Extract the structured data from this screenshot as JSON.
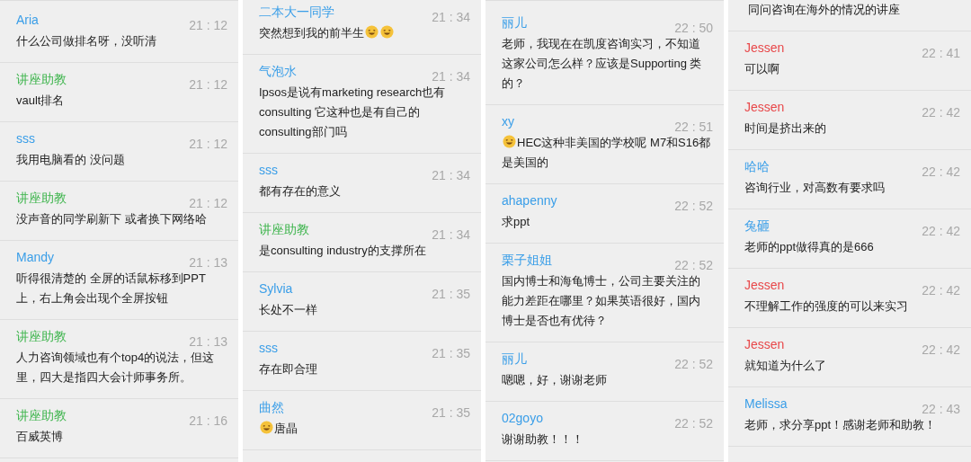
{
  "panels": [
    {
      "messages": [
        {
          "name": "Aria",
          "color": "#3a9ee8",
          "time": "21 : 12",
          "parts": [
            {
              "kind": "text",
              "text": "什么公司做排名呀，没听清"
            }
          ]
        },
        {
          "name": "讲座助教",
          "color": "#3cb44b",
          "time": "21 : 12",
          "parts": [
            {
              "kind": "text",
              "text": "vault排名"
            }
          ]
        },
        {
          "name": "sss",
          "color": "#3a9ee8",
          "time": "21 : 12",
          "parts": [
            {
              "kind": "text",
              "text": "我用电脑看的 没问题"
            }
          ]
        },
        {
          "name": "讲座助教",
          "color": "#3cb44b",
          "time": "21 : 12",
          "parts": [
            {
              "kind": "text",
              "text": "没声音的同学刷新下 或者换下网络哈"
            }
          ]
        },
        {
          "name": "Mandy",
          "color": "#3a9ee8",
          "time": "21 : 13",
          "parts": [
            {
              "kind": "text",
              "text": "听得很清楚的 全屏的话鼠标移到PPT上，右上角会出现个全屏按钮"
            }
          ]
        },
        {
          "name": "讲座助教",
          "color": "#3cb44b",
          "time": "21 : 13",
          "parts": [
            {
              "kind": "text",
              "text": "人力咨询领域也有个top4的说法，但这里，四大是指四大会计师事务所。"
            }
          ]
        },
        {
          "name": "讲座助教",
          "color": "#3cb44b",
          "time": "21 : 16",
          "parts": [
            {
              "kind": "text",
              "text": "百威英博"
            }
          ]
        }
      ]
    },
    {
      "messages": [
        {
          "name": "二本大一同学",
          "color": "#3a9ee8",
          "time": "21 : 34",
          "parts": [
            {
              "kind": "text",
              "text": "突然想到我的前半生"
            },
            {
              "kind": "emoji"
            },
            {
              "kind": "emoji"
            }
          ]
        },
        {
          "name": "气泡水",
          "color": "#3a9ee8",
          "time": "21 : 34",
          "parts": [
            {
              "kind": "text",
              "text": "Ipsos是说有marketing research也有consulting 它这种也是有自己的consulting部门吗"
            }
          ]
        },
        {
          "name": "sss",
          "color": "#3a9ee8",
          "time": "21 : 34",
          "parts": [
            {
              "kind": "text",
              "text": "都有存在的意义"
            }
          ]
        },
        {
          "name": "讲座助教",
          "color": "#3cb44b",
          "time": "21 : 34",
          "parts": [
            {
              "kind": "text",
              "text": "是consulting industry的支撑所在"
            }
          ]
        },
        {
          "name": "Sylvia",
          "color": "#3a9ee8",
          "time": "21 : 35",
          "parts": [
            {
              "kind": "text",
              "text": "长处不一样"
            }
          ]
        },
        {
          "name": "sss",
          "color": "#3a9ee8",
          "time": "21 : 35",
          "parts": [
            {
              "kind": "text",
              "text": "存在即合理"
            }
          ]
        },
        {
          "name": "曲然",
          "color": "#3a9ee8",
          "time": "21 : 35",
          "parts": [
            {
              "kind": "emoji"
            },
            {
              "kind": "text",
              "text": "唐晶"
            }
          ]
        }
      ]
    },
    {
      "messages": [
        {
          "name": "丽儿",
          "color": "#3a9ee8",
          "time": "22 : 50",
          "parts": [
            {
              "kind": "text",
              "text": "老师，我现在在凯度咨询实习，不知道这家公司怎么样？应该是Supporting 类的？"
            }
          ]
        },
        {
          "name": "xy",
          "color": "#3a9ee8",
          "time": "22 : 51",
          "parts": [
            {
              "kind": "emoji"
            },
            {
              "kind": "text",
              "text": "HEC这种非美国的学校呢 M7和S16都是美国的"
            }
          ]
        },
        {
          "name": "ahapenny",
          "color": "#3a9ee8",
          "time": "22 : 52",
          "parts": [
            {
              "kind": "text",
              "text": "求ppt"
            }
          ]
        },
        {
          "name": "栗子姐姐",
          "color": "#3a9ee8",
          "time": "22 : 52",
          "parts": [
            {
              "kind": "text",
              "text": "国内博士和海龟博士，公司主要关注的能力差距在哪里？如果英语很好，国内博士是否也有优待？"
            }
          ]
        },
        {
          "name": "丽儿",
          "color": "#3a9ee8",
          "time": "22 : 52",
          "parts": [
            {
              "kind": "text",
              "text": "嗯嗯，好，谢谢老师"
            }
          ]
        },
        {
          "name": "02goyo",
          "color": "#3a9ee8",
          "time": "22 : 52",
          "parts": [
            {
              "kind": "text",
              "text": "谢谢助教！！！"
            }
          ]
        }
      ]
    },
    {
      "fragment": "同问咨询在海外的情况的讲座",
      "messages": [
        {
          "name": "Jessen",
          "color": "#e8484a",
          "time": "22 : 41",
          "parts": [
            {
              "kind": "text",
              "text": "可以啊"
            }
          ]
        },
        {
          "name": "Jessen",
          "color": "#e8484a",
          "time": "22 : 42",
          "parts": [
            {
              "kind": "text",
              "text": "时间是挤出来的"
            }
          ]
        },
        {
          "name": "哈哈",
          "color": "#3a9ee8",
          "time": "22 : 42",
          "parts": [
            {
              "kind": "text",
              "text": "咨询行业，对高数有要求吗"
            }
          ]
        },
        {
          "name": "兔砸",
          "color": "#3a9ee8",
          "time": "22 : 42",
          "parts": [
            {
              "kind": "text",
              "text": "老师的ppt做得真的是666"
            }
          ]
        },
        {
          "name": "Jessen",
          "color": "#e8484a",
          "time": "22 : 42",
          "parts": [
            {
              "kind": "text",
              "text": "不理解工作的强度的可以来实习"
            }
          ]
        },
        {
          "name": "Jessen",
          "color": "#e8484a",
          "time": "22 : 42",
          "parts": [
            {
              "kind": "text",
              "text": "就知道为什么了"
            }
          ]
        },
        {
          "name": "Melissa",
          "color": "#3a9ee8",
          "time": "22 : 43",
          "parts": [
            {
              "kind": "text",
              "text": "老师，求分享ppt！感谢老师和助教！"
            }
          ]
        }
      ]
    }
  ]
}
